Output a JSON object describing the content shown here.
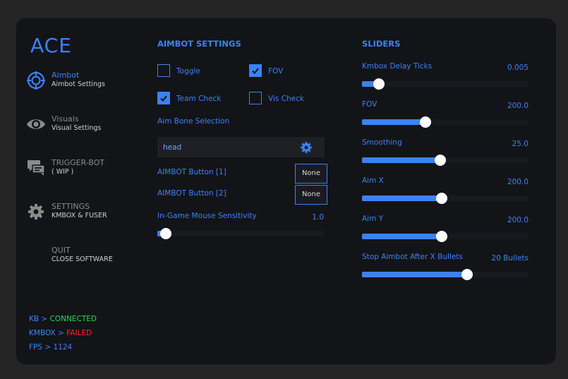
{
  "app": {
    "logo": "ACE"
  },
  "colors": {
    "accent": "#3b82f6",
    "ok": "#2dd94a",
    "fail": "#ff2a2a",
    "panel": "#131418",
    "background": "#242424"
  },
  "nav": [
    {
      "title": "Aimbot",
      "subtitle": "Aimbot Settings",
      "icon": "crosshair-icon",
      "active": true
    },
    {
      "title": "Visuals",
      "subtitle": "Visual Settings",
      "icon": "eye-icon",
      "active": false
    },
    {
      "title": "TRIGGER-BOT",
      "subtitle": "( WIP )",
      "icon": "chat-icon",
      "active": false
    },
    {
      "title": "SETTINGS",
      "subtitle": "KMBOX & FUSER",
      "icon": "gear-icon",
      "active": false
    },
    {
      "title": "QUIT",
      "subtitle": "CLOSE SOFTWARE",
      "icon": "",
      "active": false
    }
  ],
  "aimbot": {
    "title": "AIMBOT SETTINGS",
    "checkboxes": [
      {
        "label": "Toggle",
        "checked": false
      },
      {
        "label": "FOV",
        "checked": true
      },
      {
        "label": "Team Check",
        "checked": true
      },
      {
        "label": "Vis Check",
        "checked": false
      }
    ],
    "bone_label": "Aim Bone Selection",
    "bone_value": "head",
    "button1_label": "AIMBOT Button [1]",
    "button1_value": "None",
    "button2_label": "AIMBOT Button [2]",
    "button2_value": "None",
    "sensitivity_label": "In-Game Mouse Sensitivity",
    "sensitivity_value": "1.0",
    "sensitivity_fraction": 0.05
  },
  "sliders": {
    "title": "SLIDERS",
    "items": [
      {
        "label": "Kmbox Delay Ticks",
        "value": "0.005",
        "fraction": 0.1
      },
      {
        "label": "FOV",
        "value": "200.0",
        "fraction": 0.38
      },
      {
        "label": "Smoothing",
        "value": "25.0",
        "fraction": 0.47
      },
      {
        "label": "Aim X",
        "value": "200.0",
        "fraction": 0.48
      },
      {
        "label": "Aim Y",
        "value": "200.0",
        "fraction": 0.48
      },
      {
        "label": "Stop Aimbot After X Bullets",
        "value": "20 Bullets",
        "fraction": 0.63
      }
    ]
  },
  "status": {
    "kb_label": "KB > ",
    "kb_value": "CONNECTED",
    "kmbox_label": "KMBOX > ",
    "kmbox_value": "FAILED",
    "fps_label": "FPS > ",
    "fps_value": "1124"
  }
}
